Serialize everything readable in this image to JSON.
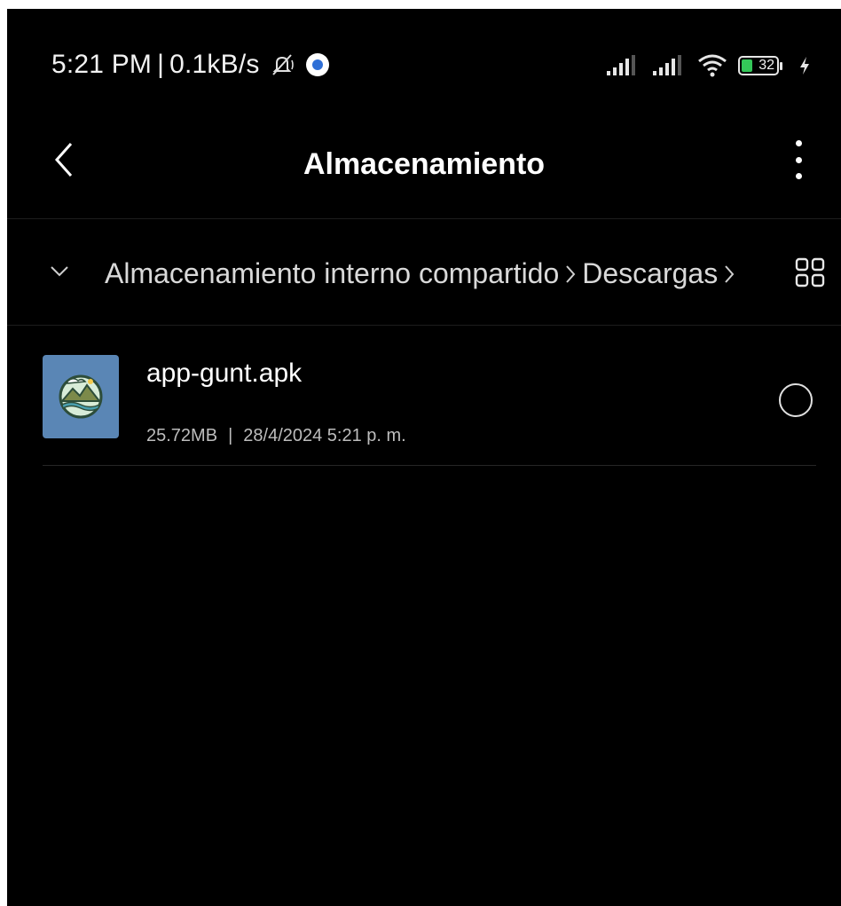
{
  "status_bar": {
    "time": "5:21 PM",
    "separator": "|",
    "network_speed": "0.1kB/s",
    "icons": [
      "notifications-muted-icon",
      "app-notification-icon",
      "signal-icon",
      "signal-icon",
      "wifi-icon",
      "battery-icon",
      "charging-icon"
    ],
    "battery_level": "32"
  },
  "header": {
    "title": "Almacenamiento",
    "back_icon": "chevron-left-icon",
    "more_icon": "more-vertical-icon"
  },
  "breadcrumb": {
    "toggle_icon": "chevron-down-icon",
    "items": [
      "Almacenamiento interno compartido",
      "Descargas"
    ],
    "view_icon": "grid-view-icon"
  },
  "files": [
    {
      "name": "app-gunt.apk",
      "size": "25.72MB",
      "meta_separator": "|",
      "date": "28/4/2024 5:21 p. m.",
      "icon": "apk-app-icon",
      "selected": false
    }
  ],
  "colors": {
    "background": "#000000",
    "text_primary": "#ffffff",
    "text_secondary": "#bdbdbd",
    "app_icon_bg": "#5a86b5",
    "battery_fill": "#34c759"
  }
}
